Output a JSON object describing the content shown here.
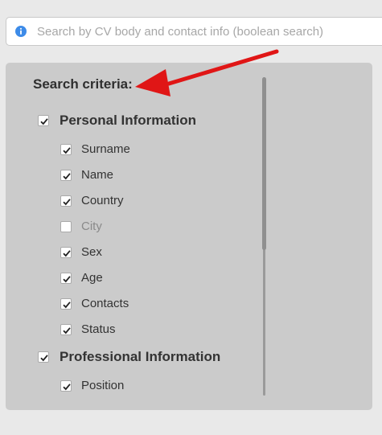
{
  "search": {
    "placeholder": "Search by CV body and contact info (boolean search)",
    "value": ""
  },
  "icons": {
    "info": "info-circle-icon",
    "checkbox_check": "checkmark-icon"
  },
  "colors": {
    "info_icon": "#3d8be8",
    "annotation_arrow": "#e01616",
    "panel_background": "#cbcbcb"
  },
  "criteria": {
    "title": "Search criteria:",
    "groups": [
      {
        "label": "Personal Information",
        "checked": true,
        "items": [
          {
            "label": "Surname",
            "checked": true
          },
          {
            "label": "Name",
            "checked": true
          },
          {
            "label": "Country",
            "checked": true
          },
          {
            "label": "City",
            "checked": false
          },
          {
            "label": "Sex",
            "checked": true
          },
          {
            "label": "Age",
            "checked": true
          },
          {
            "label": "Contacts",
            "checked": true
          },
          {
            "label": "Status",
            "checked": true
          }
        ]
      },
      {
        "label": "Professional Information",
        "checked": true,
        "items": [
          {
            "label": "Position",
            "checked": true
          }
        ]
      }
    ]
  }
}
